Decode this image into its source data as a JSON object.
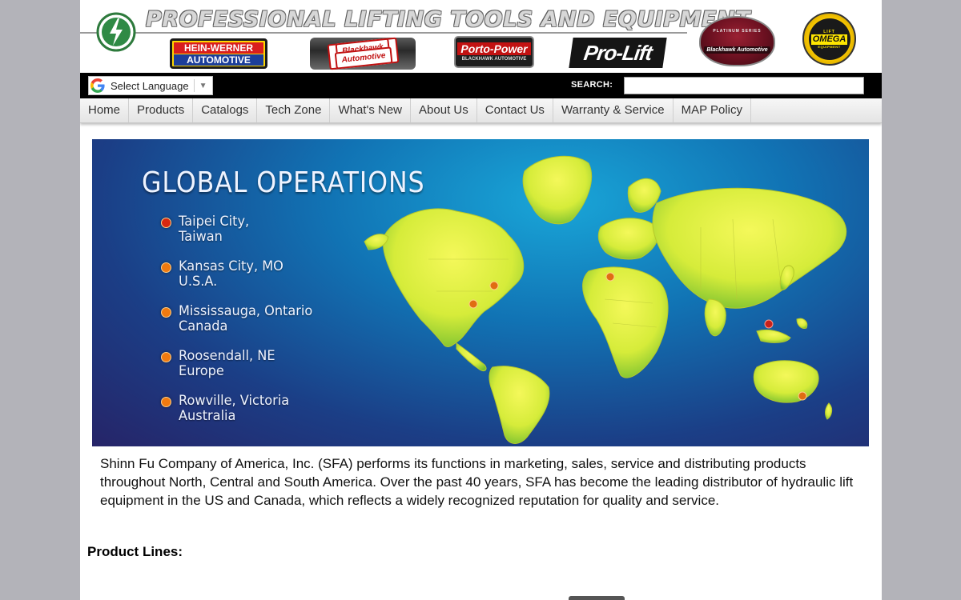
{
  "header": {
    "tagline": "PROFESSIONAL LIFTING TOOLS AND EQUIPMENT",
    "brands": [
      {
        "line1": "HEIN-WERNER",
        "line2": "AUTOMOTIVE"
      },
      {
        "line1": "Blackhawk",
        "line2": "Automotive"
      },
      {
        "line1": "Porto-Power",
        "line2": "BLACKHAWK AUTOMOTIVE"
      },
      {
        "line1": "Pro-Lift"
      },
      {
        "line1": "PLATINUM SERIES",
        "line2": "Blackhawk Automotive"
      },
      {
        "line1": "LIFT",
        "line2": "OMEGA",
        "line3": "EQUIPMENT"
      }
    ]
  },
  "utility": {
    "language_label": "Select Language",
    "language_arrow": "▼",
    "search_label": "SEARCH:",
    "search_value": ""
  },
  "nav": {
    "items": [
      {
        "label": "Home"
      },
      {
        "label": "Products"
      },
      {
        "label": "Catalogs"
      },
      {
        "label": "Tech Zone"
      },
      {
        "label": "What's New"
      },
      {
        "label": "About Us"
      },
      {
        "label": "Contact Us"
      },
      {
        "label": "Warranty & Service"
      },
      {
        "label": "MAP Policy"
      }
    ]
  },
  "banner": {
    "title": "GLOBAL OPERATIONS",
    "locations": [
      {
        "city": "Taipei City,",
        "region": "Taiwan",
        "color": "#d82810"
      },
      {
        "city": "Kansas City, MO",
        "region": "U.S.A.",
        "color": "#f07a10"
      },
      {
        "city": "Mississauga, Ontario",
        "region": "Canada",
        "color": "#f07a10"
      },
      {
        "city": "Roosendall, NE",
        "region": "Europe",
        "color": "#f07a10"
      },
      {
        "city": "Rowville, Victoria",
        "region": "Australia",
        "color": "#f07a10"
      }
    ]
  },
  "content": {
    "intro": "Shinn Fu Company of America, Inc. (SFA) performs its functions in marketing, sales, service and distributing products throughout North, Central and South America. Over the past 40 years, SFA has become the leading distributor of hydraulic lift equipment in the US and Canada, which reflects a widely recognized reputation for quality and service.",
    "product_lines_heading": "Product Lines:"
  },
  "colors": {
    "accent_black": "#000000",
    "page_bg": "#b3b3b9",
    "map_land": "#e8f23a",
    "pin_orange": "#f07a10",
    "pin_red": "#d82810"
  }
}
